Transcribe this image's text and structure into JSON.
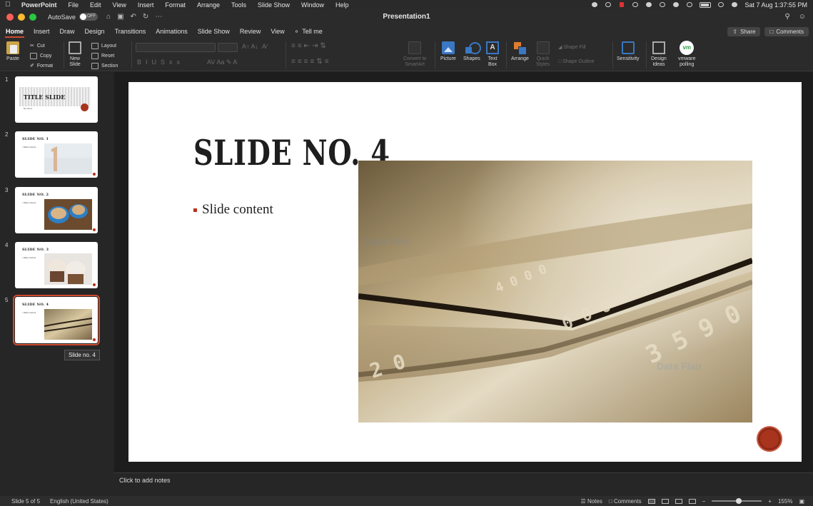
{
  "menubar": {
    "app_name": "PowerPoint",
    "items": [
      "File",
      "Edit",
      "View",
      "Insert",
      "Format",
      "Arrange",
      "Tools",
      "Slide Show",
      "Window",
      "Help"
    ],
    "datetime": "Sat 7 Aug  1:37:55 PM"
  },
  "titlebar": {
    "autosave_label": "AutoSave",
    "autosave_state": "OFF",
    "document_title": "Presentation1"
  },
  "ribbon_tabs": {
    "tabs": [
      "Home",
      "Insert",
      "Draw",
      "Design",
      "Transitions",
      "Animations",
      "Slide Show",
      "Review",
      "View"
    ],
    "active": "Home",
    "tell_me": "Tell me",
    "share_label": "Share",
    "comments_label": "Comments"
  },
  "ribbon": {
    "paste": "Paste",
    "cut": "Cut",
    "copy": "Copy",
    "format": "Format",
    "new_slide_1": "New",
    "new_slide_2": "Slide",
    "layout": "Layout",
    "reset": "Reset",
    "section": "Section",
    "convert_smartart_1": "Convert to",
    "convert_smartart_2": "SmartArt",
    "picture": "Picture",
    "shapes": "Shapes",
    "text_box_1": "Text",
    "text_box_2": "Box",
    "arrange": "Arrange",
    "quick_styles_1": "Quick",
    "quick_styles_2": "Styles",
    "shape_fill": "Shape Fill",
    "shape_outline": "Shape Outline",
    "sensitivity": "Sensitivity",
    "design_ideas_1": "Design",
    "design_ideas_2": "Ideas",
    "vmware_badge": "vm",
    "vmware_1": "vmware",
    "vmware_2": "polling"
  },
  "thumbnails": [
    {
      "number": "1",
      "title": "TITLE SLIDE",
      "subtitle": "By Name"
    },
    {
      "number": "2",
      "title": "SLIDE NO. 1",
      "bullet": "• Slide content"
    },
    {
      "number": "3",
      "title": "SLIDE NO. 2",
      "bullet": "• Slide content"
    },
    {
      "number": "4",
      "title": "SLIDE NO. 3",
      "bullet": "• Slide content"
    },
    {
      "number": "5",
      "title": "SLIDE NO. 4",
      "bullet": "• Slide content"
    }
  ],
  "tooltip": "Slide no. 4",
  "slide": {
    "title": "SLIDE NO. 4",
    "bullet": "Slide content"
  },
  "notes_placeholder": "Click to add notes",
  "statusbar": {
    "slide_counter": "Slide 5 of 5",
    "language": "English (United States)",
    "notes": "Notes",
    "comments": "Comments",
    "zoom": "155%"
  },
  "watermark": "Data Flair"
}
